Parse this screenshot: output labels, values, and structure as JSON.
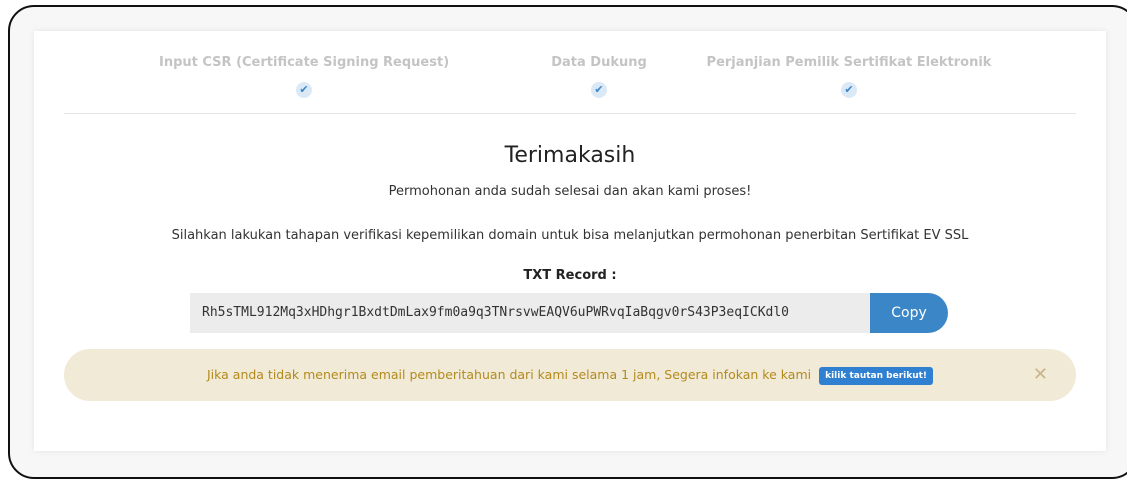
{
  "steps": [
    {
      "label": "Input CSR (Certificate Signing Request)",
      "status": "completed"
    },
    {
      "label": "Data Dukung",
      "status": "completed"
    },
    {
      "label": "Perjanjian Pemilik Sertifikat Elektronik",
      "status": "completed"
    }
  ],
  "content": {
    "title": "Terimakasih",
    "subtitle": "Permohonan anda sudah selesai dan akan kami proses!",
    "instruction": "Silahkan lakukan tahapan verifikasi kepemilikan domain untuk bisa melanjutkan permohonan penerbitan Sertifikat EV SSL",
    "txt_record_label": "TXT Record :",
    "txt_record_value": "Rh5sTML912Mq3xHDhgr1BxdtDmLax9fm0a9q3TNrsvwEAQV6uPWRvqIaBqgv0rS43P3eqICKdl0",
    "copy_label": "Copy"
  },
  "alert": {
    "message": "Jika anda tidak menerima email pemberitahuan dari kami selama 1 jam, Segera infokan ke kami",
    "link_label": "kilik tautan berikut!",
    "close_icon": "close-icon"
  },
  "colors": {
    "accent": "#3b86c6",
    "alert_bg": "#f0ead6",
    "alert_text": "#b38a1e",
    "step_label": "#c4c4c4"
  }
}
